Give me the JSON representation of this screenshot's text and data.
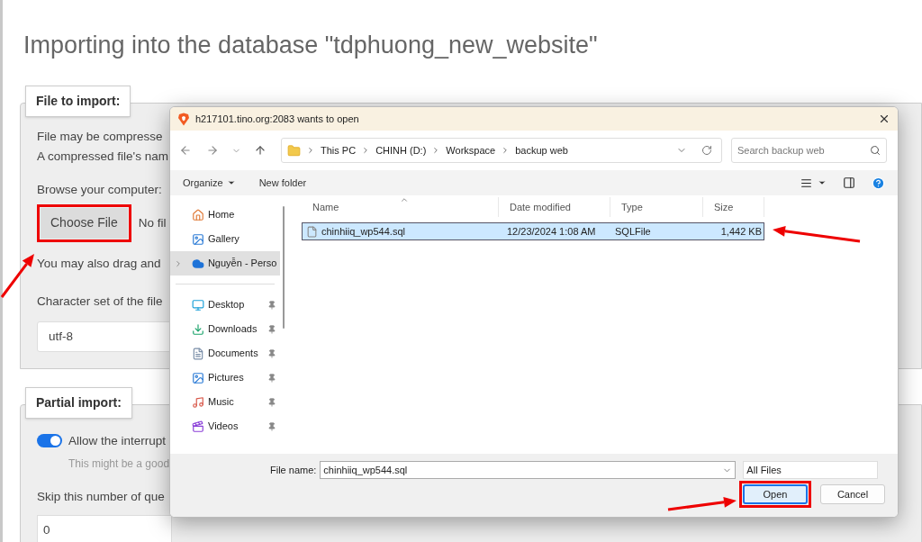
{
  "import_page": {
    "title": "Importing into the database \"tdphuong_new_website\"",
    "file_section": {
      "legend": "File to import:",
      "lines": [
        "File may be compresse",
        "A compressed file's nam"
      ],
      "browse_label": "Browse your computer:",
      "choose_button": "Choose File",
      "no_file_text": "No fil",
      "drag_text": "You may also drag and",
      "charset_label": "Character set of the file",
      "charset_value": "utf-8"
    },
    "partial_section": {
      "legend": "Partial import:",
      "interrupt_toggle": {
        "on": true,
        "label": "Allow the interrupt",
        "hint": "This might be a good"
      },
      "skip_label": "Skip this number of que",
      "skip_value": "0"
    }
  },
  "dialog": {
    "title": "h217101.tino.org:2083 wants to open",
    "breadcrumb": [
      "This PC",
      "CHINH (D:)",
      "Workspace",
      "backup web"
    ],
    "search": {
      "placeholder": "Search backup web"
    },
    "toolbar": {
      "organize": "Organize",
      "new_folder": "New folder"
    },
    "nav_groups": [
      [
        {
          "label": "Home",
          "pinned": false,
          "selected": false,
          "expandable": false
        },
        {
          "label": "Gallery",
          "pinned": false,
          "selected": false,
          "expandable": false
        },
        {
          "label": "Nguyễn - Perso",
          "pinned": false,
          "selected": true,
          "expandable": true
        }
      ],
      [
        {
          "label": "Desktop",
          "pinned": true,
          "selected": false,
          "expandable": false
        },
        {
          "label": "Downloads",
          "pinned": true,
          "selected": false,
          "expandable": false
        },
        {
          "label": "Documents",
          "pinned": true,
          "selected": false,
          "expandable": false
        },
        {
          "label": "Pictures",
          "pinned": true,
          "selected": false,
          "expandable": false
        },
        {
          "label": "Music",
          "pinned": true,
          "selected": false,
          "expandable": false
        },
        {
          "label": "Videos",
          "pinned": true,
          "selected": false,
          "expandable": false
        }
      ]
    ],
    "columns": [
      {
        "label": "Name",
        "sorted": true
      },
      {
        "label": "Date modified",
        "sorted": false
      },
      {
        "label": "Type",
        "sorted": false
      },
      {
        "label": "Size",
        "sorted": false
      }
    ],
    "files": [
      {
        "name": "chinhiiq_wp544.sql",
        "date": "12/23/2024 1:08 AM",
        "type": "SQLFile",
        "size": "1,442 KB",
        "selected": true
      }
    ],
    "file_name_label": "File name:",
    "file_name_value": "chinhiiq_wp544.sql",
    "file_type": "All Files",
    "buttons": [
      {
        "label": "Open",
        "default": true,
        "highlighted": true
      },
      {
        "label": "Cancel",
        "default": false,
        "highlighted": false
      }
    ]
  }
}
